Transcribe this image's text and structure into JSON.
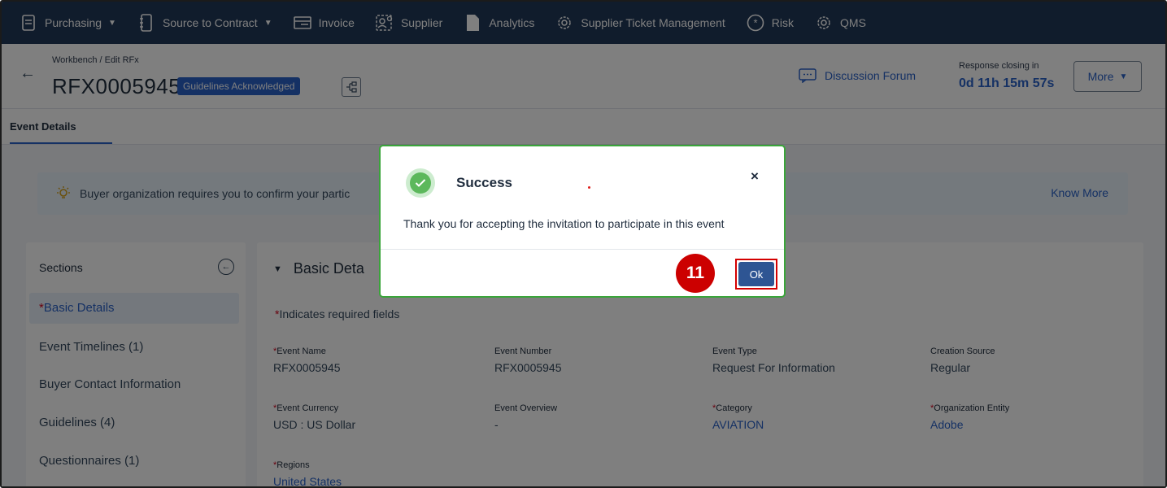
{
  "nav": {
    "items": [
      {
        "label": "Purchasing",
        "icon": "purchasing-doc-icon",
        "dropdown": true
      },
      {
        "label": "Source to Contract",
        "icon": "contract-doc-icon",
        "dropdown": true
      },
      {
        "label": "Invoice",
        "icon": "invoice-icon",
        "dropdown": false
      },
      {
        "label": "Supplier",
        "icon": "supplier-icon",
        "dropdown": false
      },
      {
        "label": "Analytics",
        "icon": "analytics-icon",
        "dropdown": false
      },
      {
        "label": "Supplier Ticket Management",
        "icon": "gear-icon",
        "dropdown": false
      },
      {
        "label": "Risk",
        "icon": "risk-icon",
        "dropdown": false
      },
      {
        "label": "QMS",
        "icon": "gear-icon",
        "dropdown": false
      }
    ]
  },
  "header": {
    "breadcrumb": "Workbench / Edit RFx",
    "title": "RFX0005945",
    "badge": "Guidelines Acknowledged",
    "forum_label": "Discussion Forum",
    "closing_label": "Response closing in",
    "closing_value": "0d 11h 15m 57s",
    "more_label": "More"
  },
  "tabs": {
    "active": "Event Details"
  },
  "banner": {
    "text": "Buyer organization requires you to confirm your partic",
    "link": "Know More"
  },
  "sections": {
    "heading": "Sections",
    "items": [
      {
        "label": "Basic Details",
        "required": true,
        "active": true
      },
      {
        "label": "Event Timelines (1)"
      },
      {
        "label": "Buyer Contact Information"
      },
      {
        "label": "Guidelines (4)"
      },
      {
        "label": "Questionnaires (1)"
      }
    ]
  },
  "main": {
    "heading": "Basic Deta",
    "required_note": "Indicates required fields",
    "fields": {
      "event_name": {
        "label": "Event Name",
        "value": "RFX0005945"
      },
      "event_number": {
        "label": "Event Number",
        "value": "RFX0005945"
      },
      "event_type": {
        "label": "Event Type",
        "value": "Request For Information"
      },
      "creation_source": {
        "label": "Creation Source",
        "value": "Regular"
      },
      "event_currency": {
        "label": "Event Currency",
        "value": "USD : US Dollar"
      },
      "event_overview": {
        "label": "Event Overview",
        "value": "-"
      },
      "category": {
        "label": "Category",
        "value": "AVIATION"
      },
      "organization_entity": {
        "label": "Organization Entity",
        "value": "Adobe"
      },
      "regions": {
        "label": "Regions",
        "value": "United States"
      }
    }
  },
  "modal": {
    "title": "Success",
    "message": "Thank you for accepting the invitation to participate in this event",
    "close": "×",
    "ok_label": "Ok"
  },
  "annotation": {
    "step": "11"
  },
  "colors": {
    "nav_bg": "#213858",
    "accent": "#2a62c9",
    "ok_button": "#2e5593",
    "success": "#5cb85c",
    "highlight": "#d40000"
  }
}
